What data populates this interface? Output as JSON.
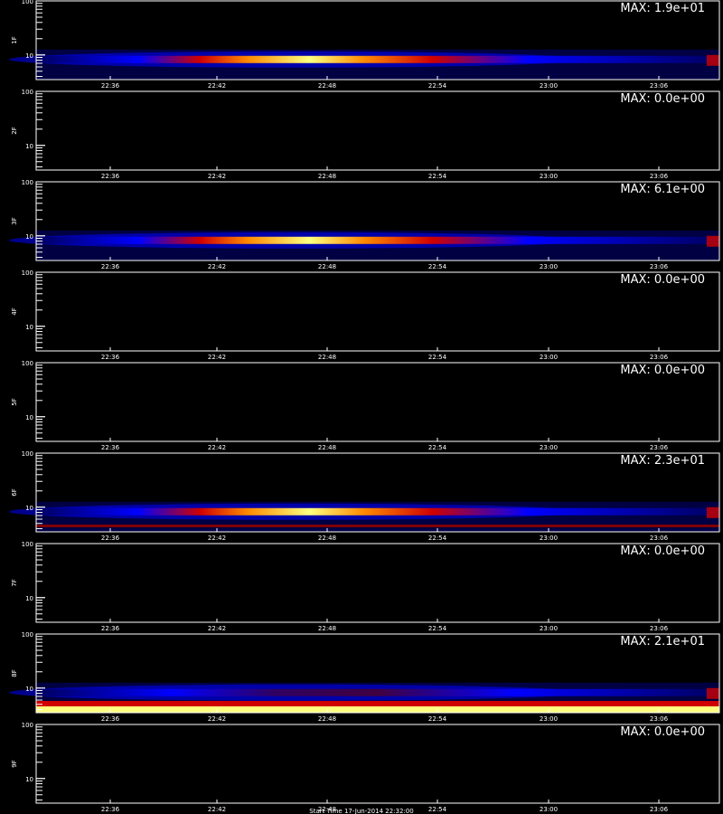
{
  "chart_data": {
    "type": "heatmap",
    "x_tick_labels": [
      "22:36",
      "22:42",
      "22:48",
      "22:54",
      "23:00",
      "23:06"
    ],
    "y_tick_labels": [
      "100",
      "10"
    ],
    "ylim": [
      3.5,
      100
    ],
    "y_scale": "log",
    "colormap": [
      "#000000",
      "#000060",
      "#0000ff",
      "#d00000",
      "#ff8a00",
      "#ffff80",
      "#ffffff"
    ],
    "panels": [
      {
        "ylabel": "1F",
        "max_text": "MAX: 1.9e+01",
        "max": 19.0
      },
      {
        "ylabel": "2F",
        "max_text": "MAX: 0.0e+00",
        "max": 0.0
      },
      {
        "ylabel": "3F",
        "max_text": "MAX: 6.1e+00",
        "max": 6.1
      },
      {
        "ylabel": "4F",
        "max_text": "MAX: 0.0e+00",
        "max": 0.0
      },
      {
        "ylabel": "5F",
        "max_text": "MAX: 0.0e+00",
        "max": 0.0
      },
      {
        "ylabel": "6F",
        "max_text": "MAX: 2.3e+01",
        "max": 23.0
      },
      {
        "ylabel": "7F",
        "max_text": "MAX: 0.0e+00",
        "max": 0.0
      },
      {
        "ylabel": "8F",
        "max_text": "MAX: 2.1e+01",
        "max": 21.0
      },
      {
        "ylabel": "9F",
        "max_text": "MAX: 0.0e+00",
        "max": 0.0
      }
    ]
  },
  "footer": "Start Time 17-Jun-2014 22:32:00"
}
